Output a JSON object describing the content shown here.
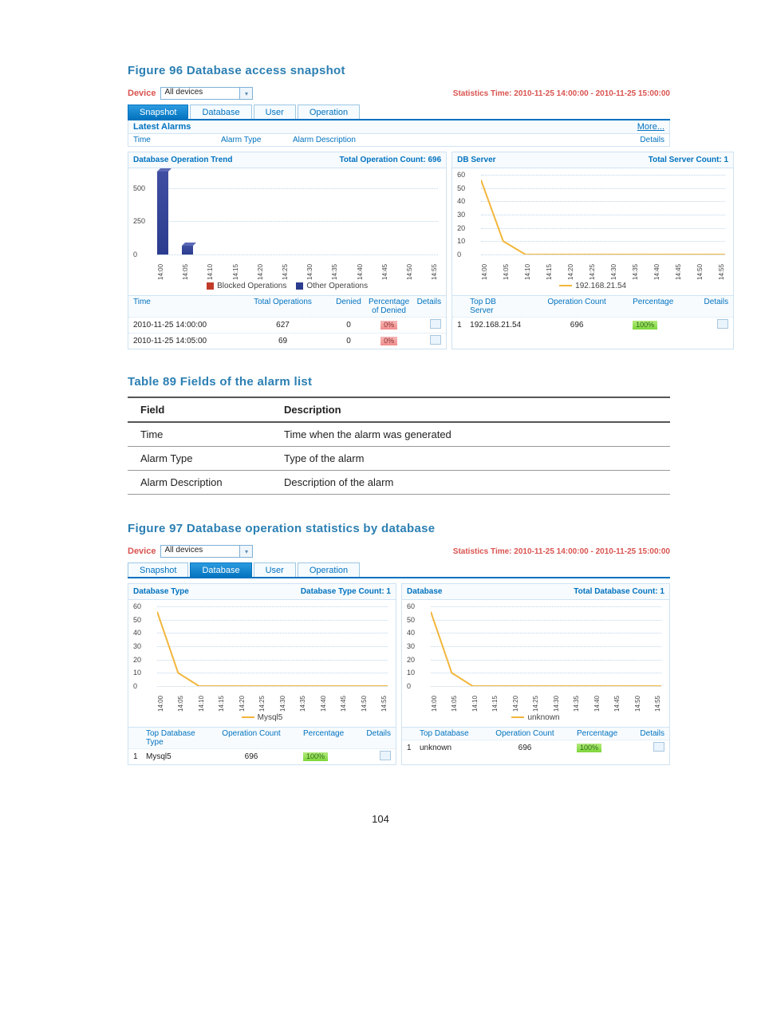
{
  "page_number": "104",
  "figure96": {
    "caption": "Figure 96 Database access snapshot",
    "device_label": "Device",
    "device_value": "All devices",
    "stats_time": "Statistics Time: 2010-11-25 14:00:00 - 2010-11-25 15:00:00",
    "tabs": [
      "Snapshot",
      "Database",
      "User",
      "Operation"
    ],
    "active_tab": "Snapshot",
    "latest_alarms_label": "Latest Alarms",
    "more_label": "More...",
    "cols": {
      "time": "Time",
      "type": "Alarm Type",
      "desc": "Alarm Description",
      "details": "Details"
    },
    "left_panel": {
      "title": "Database Operation Trend",
      "right_label": "Total Operation Count: 696",
      "legend_blocked": "Blocked Operations",
      "legend_other": "Other Operations",
      "table_cols": {
        "time": "Time",
        "tot": "Total Operations",
        "den": "Denied",
        "pct": "Percentage of Denied",
        "det": "Details"
      },
      "rows": [
        {
          "time": "2010-11-25 14:00:00",
          "total": "627",
          "denied": "0",
          "pct": "0%"
        },
        {
          "time": "2010-11-25 14:05:00",
          "total": "69",
          "denied": "0",
          "pct": "0%"
        }
      ]
    },
    "right_panel": {
      "title": "DB Server",
      "right_label": "Total Server Count: 1",
      "legend_series": "192.168.21.54",
      "table_cols": {
        "rank": "",
        "top": "Top DB Server",
        "op": "Operation Count",
        "pct": "Percentage",
        "det": "Details"
      },
      "rows": [
        {
          "rank": "1",
          "name": "192.168.21.54",
          "op": "696",
          "pct": "100%"
        }
      ]
    }
  },
  "table89": {
    "caption": "Table 89 Fields of the alarm list",
    "head": {
      "field": "Field",
      "desc": "Description"
    },
    "rows": [
      {
        "f": "Time",
        "d": "Time when the alarm was generated"
      },
      {
        "f": "Alarm Type",
        "d": "Type of the alarm"
      },
      {
        "f": "Alarm Description",
        "d": "Description of the alarm"
      }
    ]
  },
  "figure97": {
    "caption": "Figure 97 Database operation statistics by database",
    "device_label": "Device",
    "device_value": "All devices",
    "stats_time": "Statistics Time: 2010-11-25 14:00:00 - 2010-11-25 15:00:00",
    "tabs": [
      "Snapshot",
      "Database",
      "User",
      "Operation"
    ],
    "active_tab": "Database",
    "left_panel": {
      "title": "Database Type",
      "right_label": "Database Type Count: 1",
      "legend_series": "Mysql5",
      "table_cols": {
        "top": "Top Database Type",
        "op": "Operation Count",
        "pct": "Percentage",
        "det": "Details"
      },
      "rows": [
        {
          "rank": "1",
          "name": "Mysql5",
          "op": "696",
          "pct": "100%"
        }
      ]
    },
    "right_panel": {
      "title": "Database",
      "right_label": "Total Database Count: 1",
      "legend_series": "unknown",
      "table_cols": {
        "top": "Top Database",
        "op": "Operation Count",
        "pct": "Percentage",
        "det": "Details"
      },
      "rows": [
        {
          "rank": "1",
          "name": "unknown",
          "op": "696",
          "pct": "100%"
        }
      ]
    }
  },
  "chart_data": [
    {
      "id": "fig96_left",
      "type": "bar",
      "title": "Database Operation Trend",
      "ylabel": "",
      "ylim": [
        0,
        600
      ],
      "yticks": [
        0,
        250,
        500
      ],
      "categories": [
        "14:00",
        "14:05",
        "14:10",
        "14:15",
        "14:20",
        "14:25",
        "14:30",
        "14:35",
        "14:40",
        "14:45",
        "14:50",
        "14:55"
      ],
      "series": [
        {
          "name": "Blocked Operations",
          "color": "#c23b2a",
          "values": [
            0,
            0,
            0,
            0,
            0,
            0,
            0,
            0,
            0,
            0,
            0,
            0
          ]
        },
        {
          "name": "Other Operations",
          "color": "#2b3c8f",
          "values": [
            627,
            69,
            0,
            0,
            0,
            0,
            0,
            0,
            0,
            0,
            0,
            0
          ]
        }
      ]
    },
    {
      "id": "fig96_right",
      "type": "line",
      "title": "DB Server",
      "ylim": [
        0,
        60
      ],
      "yticks": [
        0,
        10,
        20,
        30,
        40,
        50,
        60
      ],
      "categories": [
        "14:00",
        "14:05",
        "14:10",
        "14:15",
        "14:20",
        "14:25",
        "14:30",
        "14:35",
        "14:40",
        "14:45",
        "14:50",
        "14:55"
      ],
      "series": [
        {
          "name": "192.168.21.54",
          "color": "#f2b63c",
          "values": [
            56,
            10,
            0,
            0,
            0,
            0,
            0,
            0,
            0,
            0,
            0,
            0
          ]
        }
      ]
    },
    {
      "id": "fig97_left",
      "type": "line",
      "title": "Database Type",
      "ylim": [
        0,
        60
      ],
      "yticks": [
        0,
        10,
        20,
        30,
        40,
        50,
        60
      ],
      "categories": [
        "14:00",
        "14:05",
        "14:10",
        "14:15",
        "14:20",
        "14:25",
        "14:30",
        "14:35",
        "14:40",
        "14:45",
        "14:50",
        "14:55"
      ],
      "series": [
        {
          "name": "Mysql5",
          "color": "#f2b63c",
          "values": [
            56,
            10,
            0,
            0,
            0,
            0,
            0,
            0,
            0,
            0,
            0,
            0
          ]
        }
      ]
    },
    {
      "id": "fig97_right",
      "type": "line",
      "title": "Database",
      "ylim": [
        0,
        60
      ],
      "yticks": [
        0,
        10,
        20,
        30,
        40,
        50,
        60
      ],
      "categories": [
        "14:00",
        "14:05",
        "14:10",
        "14:15",
        "14:20",
        "14:25",
        "14:30",
        "14:35",
        "14:40",
        "14:45",
        "14:50",
        "14:55"
      ],
      "series": [
        {
          "name": "unknown",
          "color": "#f2b63c",
          "values": [
            56,
            10,
            0,
            0,
            0,
            0,
            0,
            0,
            0,
            0,
            0,
            0
          ]
        }
      ]
    }
  ]
}
